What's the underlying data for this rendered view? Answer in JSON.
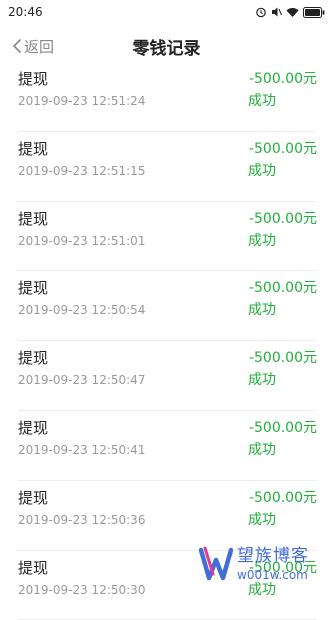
{
  "status_bar": {
    "time": "20:46"
  },
  "nav": {
    "back_label": "返回",
    "title": "零钱记录"
  },
  "records": [
    {
      "title": "提现",
      "time": "2019-09-23 12:51:24",
      "amount": "-500.00元",
      "status": "成功"
    },
    {
      "title": "提现",
      "time": "2019-09-23 12:51:15",
      "amount": "-500.00元",
      "status": "成功"
    },
    {
      "title": "提现",
      "time": "2019-09-23 12:51:01",
      "amount": "-500.00元",
      "status": "成功"
    },
    {
      "title": "提现",
      "time": "2019-09-23 12:50:54",
      "amount": "-500.00元",
      "status": "成功"
    },
    {
      "title": "提现",
      "time": "2019-09-23 12:50:47",
      "amount": "-500.00元",
      "status": "成功"
    },
    {
      "title": "提现",
      "time": "2019-09-23 12:50:41",
      "amount": "-500.00元",
      "status": "成功"
    },
    {
      "title": "提现",
      "time": "2019-09-23 12:50:36",
      "amount": "-500.00元",
      "status": "成功"
    },
    {
      "title": "提现",
      "time": "2019-09-23 12:50:30",
      "amount": "-500.00元",
      "status": "成功"
    }
  ],
  "watermark": {
    "name": "望族博客",
    "url": "w001w.com"
  },
  "colors": {
    "success": "#21b03a",
    "secondary_text": "#9a9a9a",
    "brand_blue": "#3a66d6"
  }
}
